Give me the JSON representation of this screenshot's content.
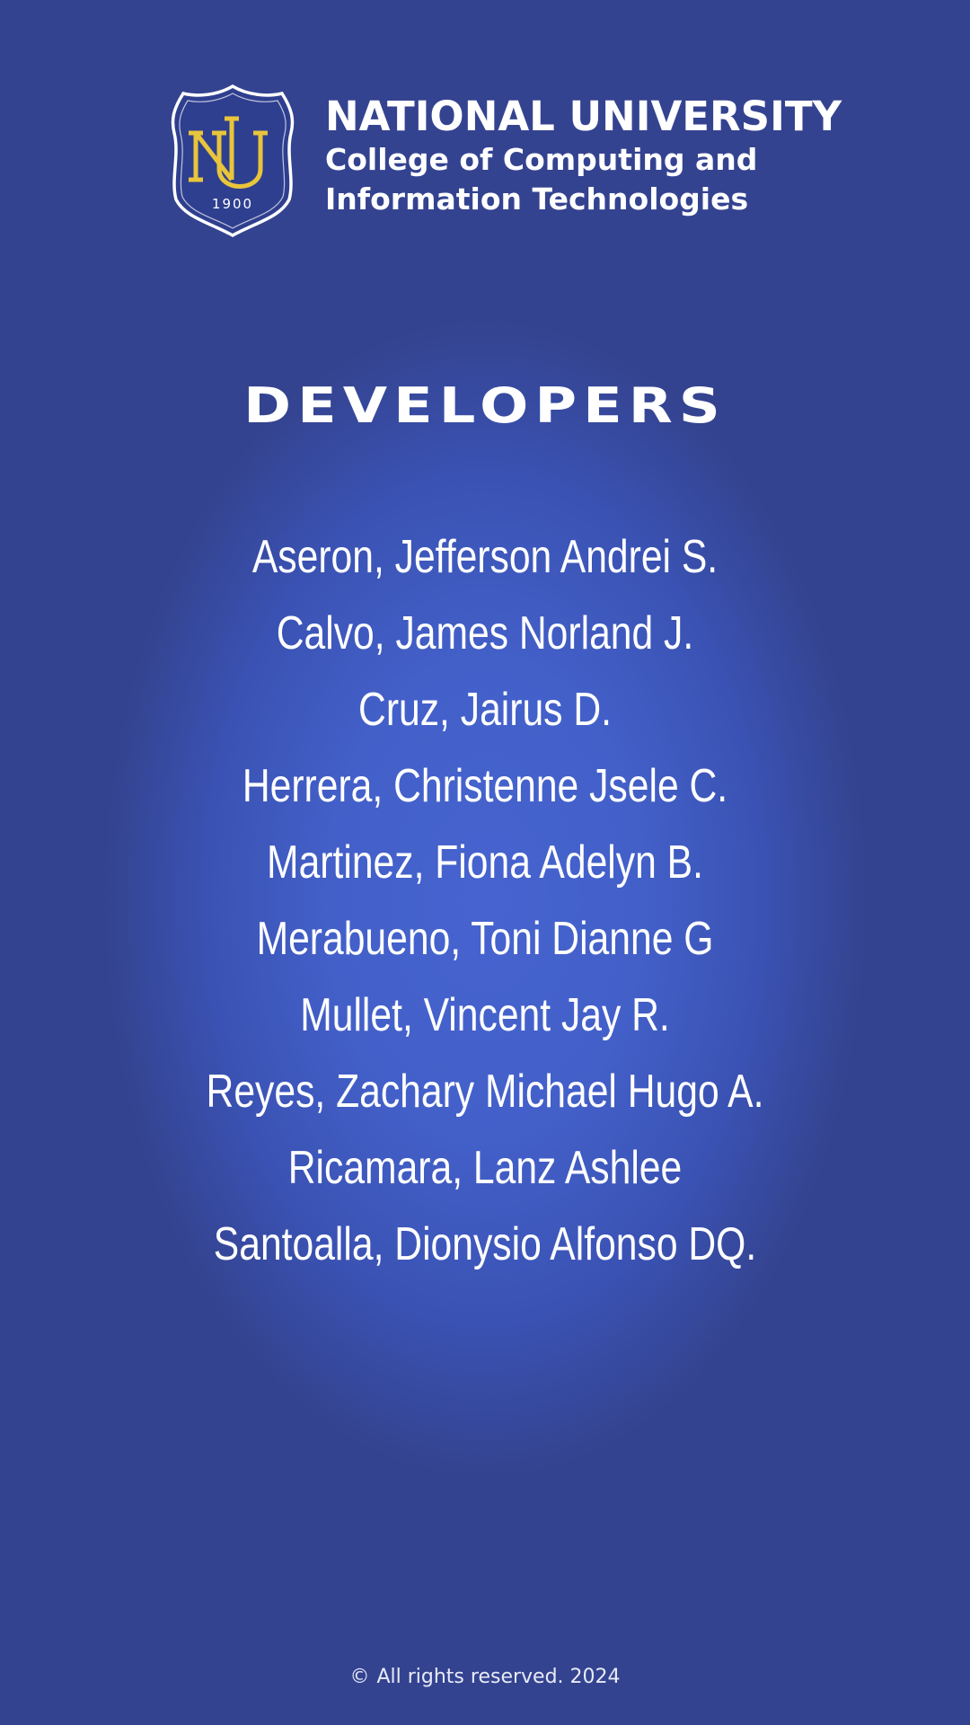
{
  "header": {
    "crest": {
      "letters": "NU",
      "year": "1900"
    },
    "university": "NATIONAL UNIVERSITY",
    "college_line1": "College of Computing and",
    "college_line2": "Information Technologies"
  },
  "section": {
    "title": "DEVELOPERS"
  },
  "developers": [
    "Aseron, Jefferson Andrei S.",
    "Calvo, James Norland J.",
    "Cruz, Jairus D.",
    "Herrera, Christenne Jsele C.",
    "Martinez, Fiona Adelyn B.",
    "Merabueno, Toni Dianne G",
    "Mullet, Vincent Jay R.",
    "Reyes, Zachary Michael Hugo A.",
    "Ricamara, Lanz Ashlee",
    "Santoalla, Dionysio Alfonso DQ."
  ],
  "footer": {
    "copyright_symbol": "©",
    "text": "All rights reserved. 2024"
  },
  "colors": {
    "background": "#344390",
    "center_glow": "#4663cf",
    "crest_gold": "#e8c53a",
    "text": "#ffffff"
  }
}
